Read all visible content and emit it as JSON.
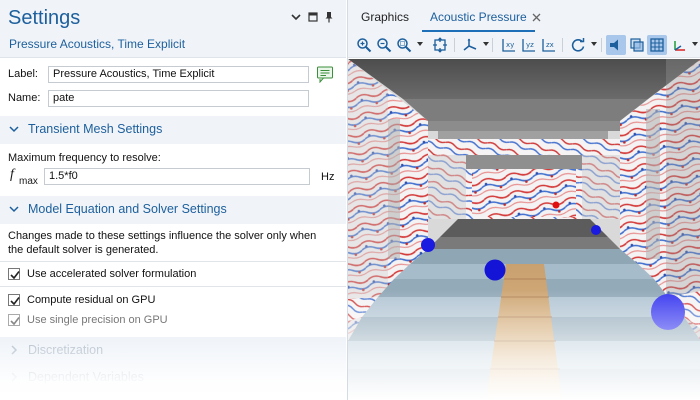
{
  "settings": {
    "title": "Settings",
    "subtitle": "Pressure Acoustics, Time Explicit",
    "label_caption": "Label:",
    "label_value": "Pressure Acoustics, Time Explicit",
    "name_caption": "Name:",
    "name_value": "pate"
  },
  "sections": [
    {
      "title": "Transient Mesh Settings",
      "expanded": true
    },
    {
      "title": "Model Equation and Solver Settings",
      "expanded": true
    },
    {
      "title": "Discretization",
      "expanded": false
    },
    {
      "title": "Dependent Variables",
      "expanded": false
    }
  ],
  "mesh": {
    "caption": "Maximum frequency to resolve:",
    "symbol": "f",
    "symbol_sub": "max",
    "value": "1.5*f0",
    "unit": "Hz"
  },
  "solver": {
    "note": "Changes made to these settings influence the solver only when the default solver is generated.",
    "options": [
      {
        "label": "Use accelerated solver formulation",
        "checked": true,
        "enabled": true
      },
      {
        "label": "Compute residual on GPU",
        "checked": true,
        "enabled": true
      },
      {
        "label": "Use single precision on GPU",
        "checked": true,
        "enabled": false
      }
    ]
  },
  "graphics": {
    "tabs": [
      {
        "label": "Graphics",
        "active": false
      },
      {
        "label": "Acoustic Pressure",
        "active": true
      }
    ]
  },
  "colors": {
    "accent": "#1d5f9c",
    "header_bg": "#f0f4f9",
    "active_tool": "#a9c7ea",
    "source_blue": "#1a1ae0",
    "receiver_red": "#e01010"
  },
  "icons": [
    "collapse-menu-icon",
    "restore-window-icon",
    "pin-icon",
    "label-edit-icon",
    "chevron-down-icon",
    "chevron-right-icon",
    "checkmark-icon",
    "close-icon",
    "zoom-in-icon",
    "zoom-out-icon",
    "zoom-box-icon",
    "zoom-extents-icon",
    "axes-orientation-icon",
    "xy-view-icon",
    "yz-view-icon",
    "zx-view-icon",
    "rotate-icon",
    "scene-light-icon",
    "transparency-icon",
    "grid-icon",
    "axis-triad-icon"
  ]
}
